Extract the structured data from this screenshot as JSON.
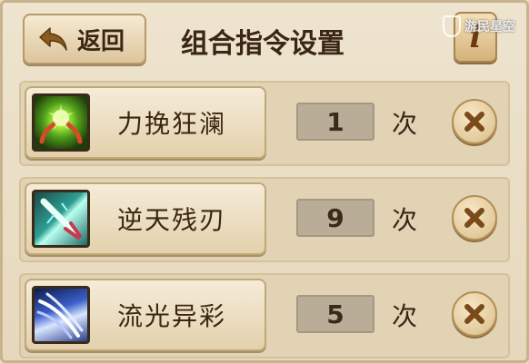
{
  "header": {
    "back_label": "返回",
    "title": "组合指令设置",
    "info_label": "i",
    "watermark": "游民星空"
  },
  "rows": [
    {
      "name": "力挽狂澜",
      "count": "1",
      "unit": "次",
      "icon": "green-energy-hands-icon"
    },
    {
      "name": "逆天残刃",
      "count": "9",
      "unit": "次",
      "icon": "teal-blade-icon"
    },
    {
      "name": "流光异彩",
      "count": "5",
      "unit": "次",
      "icon": "blue-claw-streaks-icon"
    }
  ],
  "colors": {
    "background": "#e6d8bd",
    "text": "#3a2614",
    "remove_x": "#7a4a1a"
  }
}
